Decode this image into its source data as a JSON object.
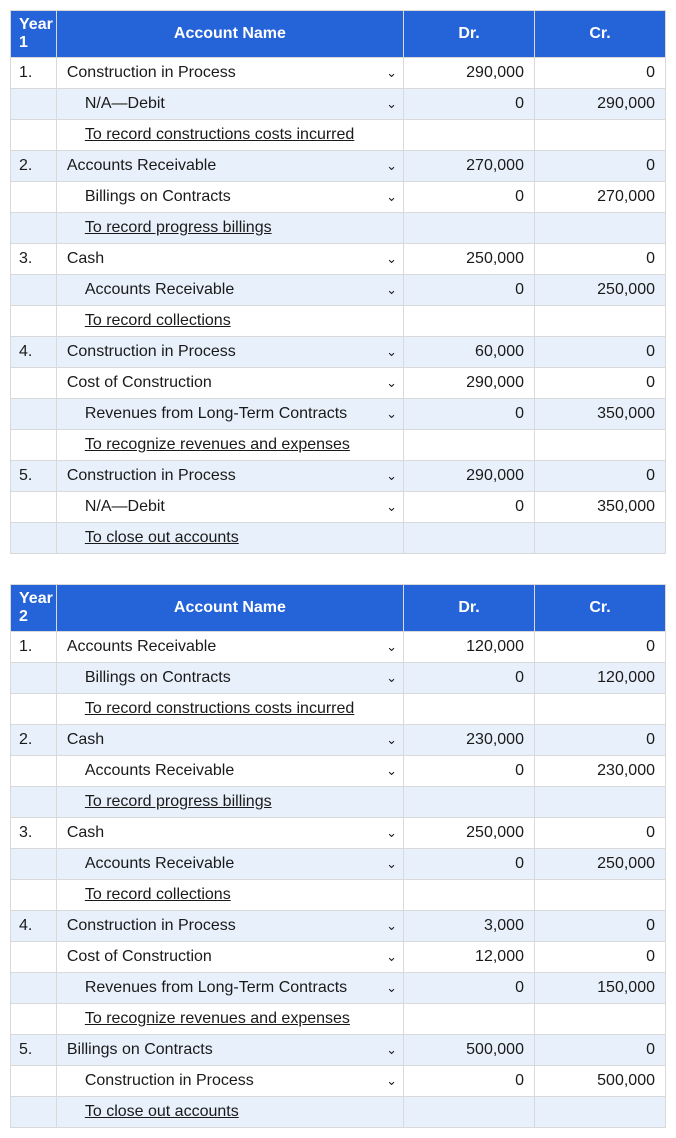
{
  "tables": [
    {
      "header": {
        "year": "Year 1",
        "name": "Account Name",
        "dr": "Dr.",
        "cr": "Cr."
      },
      "rows": [
        {
          "n": "1.",
          "label": "Construction in Process",
          "ind": 0,
          "dd": true,
          "dr": "290,000",
          "cr": "0",
          "alt": 0
        },
        {
          "n": "",
          "label": "N/A—Debit",
          "ind": 1,
          "dd": true,
          "dr": "0",
          "cr": "290,000",
          "alt": 1
        },
        {
          "n": "",
          "label": "To record constructions costs incurred",
          "ind": 2,
          "dd": false,
          "dr": "",
          "cr": "",
          "alt": 0
        },
        {
          "n": "2.",
          "label": "Accounts Receivable",
          "ind": 0,
          "dd": true,
          "dr": "270,000",
          "cr": "0",
          "alt": 1
        },
        {
          "n": "",
          "label": "Billings on Contracts",
          "ind": 1,
          "dd": true,
          "dr": "0",
          "cr": "270,000",
          "alt": 0
        },
        {
          "n": "",
          "label": "To record progress billings",
          "ind": 2,
          "dd": false,
          "dr": "",
          "cr": "",
          "alt": 1
        },
        {
          "n": "3.",
          "label": "Cash",
          "ind": 0,
          "dd": true,
          "dr": "250,000",
          "cr": "0",
          "alt": 0
        },
        {
          "n": "",
          "label": "Accounts Receivable",
          "ind": 1,
          "dd": true,
          "dr": "0",
          "cr": "250,000",
          "alt": 1
        },
        {
          "n": "",
          "label": "To record collections",
          "ind": 2,
          "dd": false,
          "dr": "",
          "cr": "",
          "alt": 0
        },
        {
          "n": "4.",
          "label": "Construction in Process",
          "ind": 0,
          "dd": true,
          "dr": "60,000",
          "cr": "0",
          "alt": 1
        },
        {
          "n": "",
          "label": "Cost of Construction",
          "ind": 0,
          "dd": true,
          "dr": "290,000",
          "cr": "0",
          "alt": 0
        },
        {
          "n": "",
          "label": "Revenues from Long-Term Contracts",
          "ind": 1,
          "dd": true,
          "dr": "0",
          "cr": "350,000",
          "alt": 1
        },
        {
          "n": "",
          "label": "To recognize revenues and expenses",
          "ind": 2,
          "dd": false,
          "dr": "",
          "cr": "",
          "alt": 0
        },
        {
          "n": "5.",
          "label": "Construction in Process",
          "ind": 0,
          "dd": true,
          "dr": "290,000",
          "cr": "0",
          "alt": 1
        },
        {
          "n": "",
          "label": "N/A—Debit",
          "ind": 1,
          "dd": true,
          "dr": "0",
          "cr": "350,000",
          "alt": 0
        },
        {
          "n": "",
          "label": "To close out accounts",
          "ind": 2,
          "dd": false,
          "dr": "",
          "cr": "",
          "alt": 1
        }
      ]
    },
    {
      "header": {
        "year": "Year 2",
        "name": "Account Name",
        "dr": "Dr.",
        "cr": "Cr."
      },
      "rows": [
        {
          "n": "1.",
          "label": "Accounts Receivable",
          "ind": 0,
          "dd": true,
          "dr": "120,000",
          "cr": "0",
          "alt": 0
        },
        {
          "n": "",
          "label": "Billings on Contracts",
          "ind": 1,
          "dd": true,
          "dr": "0",
          "cr": "120,000",
          "alt": 1
        },
        {
          "n": "",
          "label": "To record constructions costs incurred",
          "ind": 2,
          "dd": false,
          "dr": "",
          "cr": "",
          "alt": 0
        },
        {
          "n": "2.",
          "label": "Cash",
          "ind": 0,
          "dd": true,
          "dr": "230,000",
          "cr": "0",
          "alt": 1
        },
        {
          "n": "",
          "label": "Accounts Receivable",
          "ind": 1,
          "dd": true,
          "dr": "0",
          "cr": "230,000",
          "alt": 0
        },
        {
          "n": "",
          "label": "To record progress billings",
          "ind": 2,
          "dd": false,
          "dr": "",
          "cr": "",
          "alt": 1
        },
        {
          "n": "3.",
          "label": "Cash",
          "ind": 0,
          "dd": true,
          "dr": "250,000",
          "cr": "0",
          "alt": 0
        },
        {
          "n": "",
          "label": "Accounts Receivable",
          "ind": 1,
          "dd": true,
          "dr": "0",
          "cr": "250,000",
          "alt": 1
        },
        {
          "n": "",
          "label": "To record collections",
          "ind": 2,
          "dd": false,
          "dr": "",
          "cr": "",
          "alt": 0
        },
        {
          "n": "4.",
          "label": "Construction in Process",
          "ind": 0,
          "dd": true,
          "dr": "3,000",
          "cr": "0",
          "alt": 1
        },
        {
          "n": "",
          "label": "Cost of Construction",
          "ind": 0,
          "dd": true,
          "dr": "12,000",
          "cr": "0",
          "alt": 0
        },
        {
          "n": "",
          "label": "Revenues from Long-Term Contracts",
          "ind": 1,
          "dd": true,
          "dr": "0",
          "cr": "150,000",
          "alt": 1
        },
        {
          "n": "",
          "label": "To recognize revenues and expenses",
          "ind": 2,
          "dd": false,
          "dr": "",
          "cr": "",
          "alt": 0
        },
        {
          "n": "5.",
          "label": "Billings on Contracts",
          "ind": 0,
          "dd": true,
          "dr": "500,000",
          "cr": "0",
          "alt": 1
        },
        {
          "n": "",
          "label": "Construction in Process",
          "ind": 1,
          "dd": true,
          "dr": "0",
          "cr": "500,000",
          "alt": 0
        },
        {
          "n": "",
          "label": "To close out accounts",
          "ind": 2,
          "dd": false,
          "dr": "",
          "cr": "",
          "alt": 1
        }
      ]
    }
  ]
}
